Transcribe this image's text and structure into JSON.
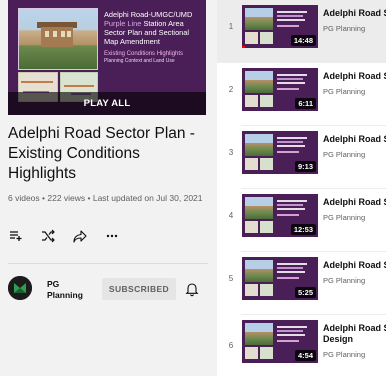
{
  "playlist": {
    "hero": {
      "title_line1": "Adelphi Road-UMGC/UMD",
      "title_accent": "Purple Line",
      "title_rest": " Station Area Sector Plan and Sectional Map Amendment",
      "subtitle": "Existing Conditions Highlights",
      "subtitle2": "Planning Context and Land Use",
      "play_all_label": "PLAY ALL"
    },
    "title": "Adelphi Road Sector Plan - Existing Conditions Highlights",
    "meta": "6 videos • 222 views • Last updated on Jul 30, 2021",
    "actions": {
      "save_icon": "add-to-queue-icon",
      "shuffle_icon": "shuffle-icon",
      "share_icon": "share-icon",
      "more_icon": "more-icon"
    },
    "owner": {
      "name": "PG Planning",
      "subscribe_label": "SUBSCRIBED",
      "bell_icon": "bell-icon"
    }
  },
  "videos": [
    {
      "index": "1",
      "title": "Adelphi Road Sector Plan - Existing Conditions Highlights",
      "title_line2": "",
      "channel": "PG Planning",
      "duration": "14:48",
      "watched": true
    },
    {
      "index": "2",
      "title": "Adelphi Road Sector Plan - Existing Conditions Highlights",
      "title_line2": "",
      "channel": "PG Planning",
      "duration": "6:11",
      "watched": false
    },
    {
      "index": "3",
      "title": "Adelphi Road Sector Plan - Existing Conditions Highlights",
      "title_line2": "",
      "channel": "PG Planning",
      "duration": "9:13",
      "watched": false
    },
    {
      "index": "4",
      "title": "Adelphi Road Sector Plan - Existing Conditions Highlights",
      "title_line2": "",
      "channel": "PG Planning",
      "duration": "12:53",
      "watched": false
    },
    {
      "index": "5",
      "title": "Adelphi Road Sector Plan - Existing Conditions Highlights",
      "title_line2": "",
      "channel": "PG Planning",
      "duration": "5:25",
      "watched": false
    },
    {
      "index": "6",
      "title": "Adelphi Road Sector Plan - Existing Conditions Highlights",
      "title_line2": "Design",
      "channel": "PG Planning",
      "duration": "4:54",
      "watched": false
    }
  ],
  "colors": {
    "thumbnail_purple": "#4a1f57",
    "accent_purple": "#d6a8e6",
    "progress_red": "#ff0000"
  }
}
